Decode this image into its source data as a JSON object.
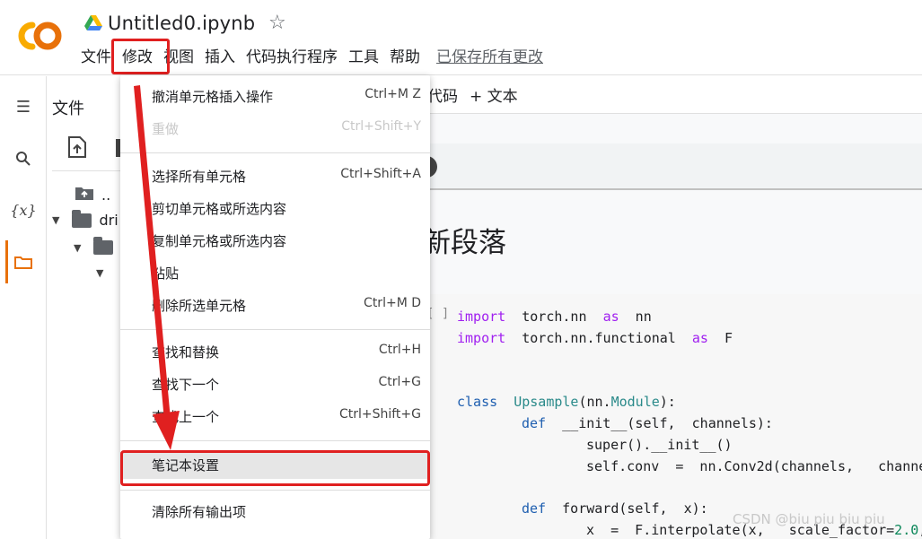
{
  "app": {
    "title": "Untitled0.ipynb"
  },
  "menubar": {
    "items": [
      "文件",
      "修改",
      "视图",
      "插入",
      "代码执行程序",
      "工具",
      "帮助"
    ],
    "saved_status": "已保存所有更改"
  },
  "sidebar": {
    "files_title": "文件",
    "tree": [
      {
        "label": "..",
        "type": "parent"
      },
      {
        "label": "dri",
        "type": "folder"
      },
      {
        "label": "",
        "type": "folder"
      }
    ]
  },
  "toolbar": {
    "code_label": "代码",
    "text_label": "+ 文本"
  },
  "notebook": {
    "heading": "新段落",
    "cell_bracket": "[ ]",
    "code_lines": [
      [
        [
          "kw",
          "import"
        ],
        [
          "t",
          "  torch.nn  "
        ],
        [
          "kw",
          "as"
        ],
        [
          "t",
          "  nn"
        ]
      ],
      [
        [
          "kw",
          "import"
        ],
        [
          "t",
          "  torch.nn.functional  "
        ],
        [
          "kw",
          "as"
        ],
        [
          "t",
          "  F"
        ]
      ],
      [
        [
          "kw2",
          "class"
        ],
        [
          "t",
          "  "
        ],
        [
          "cls",
          "Upsample"
        ],
        [
          "t",
          "(nn."
        ],
        [
          "cls",
          "Module"
        ],
        [
          "t",
          "):"
        ]
      ],
      [
        [
          "kw2",
          "def"
        ],
        [
          "t",
          "  __init__(self,  channels):"
        ]
      ],
      [
        [
          "t",
          "super().__init__()"
        ]
      ],
      [
        [
          "t",
          "self.conv  =  nn.Conv2d(channels,   channel"
        ]
      ],
      [
        [
          "kw2",
          "def"
        ],
        [
          "t",
          "  forward(self,  x):"
        ]
      ],
      [
        [
          "t",
          "x  =  F.interpolate(x,   scale_factor="
        ],
        [
          "num",
          "2.0"
        ],
        [
          "t",
          ","
        ]
      ]
    ]
  },
  "dropdown": {
    "items": [
      {
        "label": "撤消单元格插入操作",
        "shortcut": "Ctrl+M Z",
        "disabled": false
      },
      {
        "label": "重做",
        "shortcut": "Ctrl+Shift+Y",
        "disabled": true
      },
      {
        "label": "选择所有单元格",
        "shortcut": "Ctrl+Shift+A",
        "disabled": false
      },
      {
        "label": "剪切单元格或所选内容",
        "shortcut": "",
        "disabled": false
      },
      {
        "label": "复制单元格或所选内容",
        "shortcut": "",
        "disabled": false
      },
      {
        "label": "粘贴",
        "shortcut": "",
        "disabled": false
      },
      {
        "label": "删除所选单元格",
        "shortcut": "Ctrl+M D",
        "disabled": false
      },
      {
        "label": "查找和替换",
        "shortcut": "Ctrl+H",
        "disabled": false
      },
      {
        "label": "查找下一个",
        "shortcut": "Ctrl+G",
        "disabled": false
      },
      {
        "label": "查找上一个",
        "shortcut": "Ctrl+Shift+G",
        "disabled": false
      },
      {
        "label": "笔记本设置",
        "shortcut": "",
        "disabled": false
      },
      {
        "label": "清除所有输出项",
        "shortcut": "",
        "disabled": false
      }
    ]
  },
  "watermark": "CSDN @biu piu biu piu",
  "colors": {
    "accent_orange": "#e8710a",
    "annotation_red": "#e02020",
    "keyword_purple": "#a020f0",
    "keyword_blue": "#1f5fb0"
  }
}
